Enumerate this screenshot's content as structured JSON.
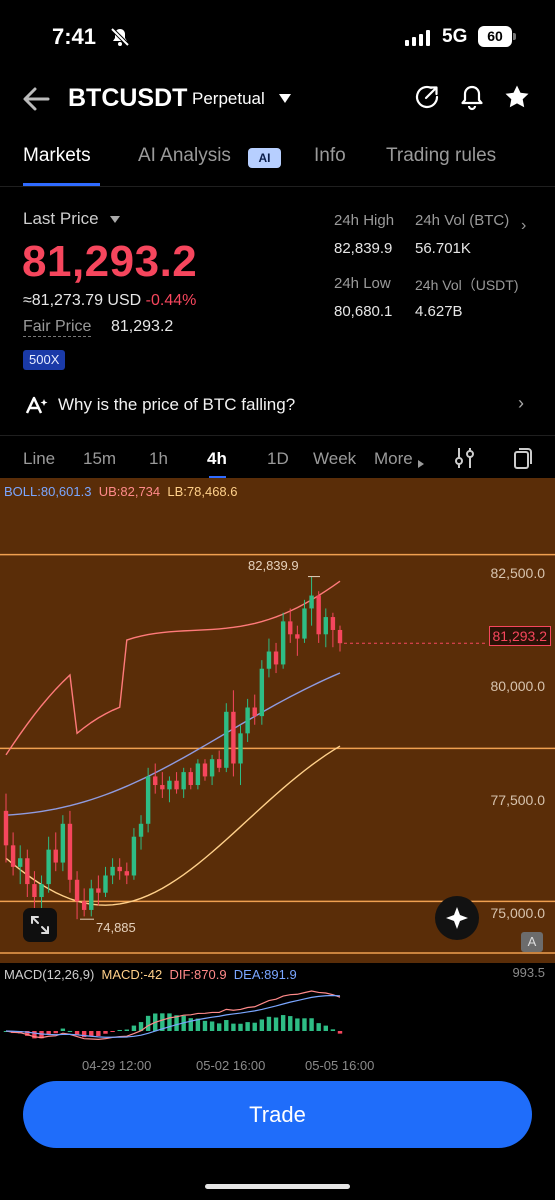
{
  "status_bar": {
    "time": "7:41",
    "network": "5G",
    "battery": "60"
  },
  "header": {
    "symbol": "BTCUSDT",
    "contract_type": "Perpetual"
  },
  "tabs": [
    {
      "label": "Markets",
      "active": true
    },
    {
      "label": "AI Analysis",
      "active": false
    },
    {
      "label": "Info",
      "active": false
    },
    {
      "label": "Trading rules",
      "active": false
    }
  ],
  "ai_badge": "AI",
  "price": {
    "last_price_label": "Last Price",
    "last_price": "81,293.2",
    "approx_usd": "≈81,273.79 USD",
    "change_pct": "-0.44%",
    "fair_price_label": "Fair Price",
    "fair_price": "81,293.2",
    "leverage": "500X"
  },
  "stats": {
    "high_label": "24h High",
    "high_value": "82,839.9",
    "vol_btc_label": "24h Vol (BTC)",
    "vol_btc_value": "56.701K",
    "low_label": "24h Low",
    "low_value": "80,680.1",
    "vol_usdt_label": "24h Vol（USDT)",
    "vol_usdt_value": "4.627B"
  },
  "insight": {
    "question": "Why is the price of BTC falling?"
  },
  "intervals": [
    {
      "label": "Line",
      "active": false
    },
    {
      "label": "15m",
      "active": false
    },
    {
      "label": "1h",
      "active": false
    },
    {
      "label": "4h",
      "active": true
    },
    {
      "label": "1D",
      "active": false
    },
    {
      "label": "Week",
      "active": false
    },
    {
      "label": "More",
      "active": false
    }
  ],
  "boll_legend": {
    "boll": "BOLL:80,601.3",
    "ub": "UB:82,734",
    "lb": "LB:78,468.6"
  },
  "macd_legend": {
    "params": "MACD(12,26,9)",
    "macd": "MACD:-42",
    "dif": "DIF:870.9",
    "dea": "DEA:891.9"
  },
  "macd_scale": "993.5",
  "annotations": {
    "high": "82,839.9",
    "low": "74,885"
  },
  "current_price_tag": "81,293.2",
  "axis_badge": "A",
  "colors": {
    "up": "#2ebd85",
    "down": "#f6465d",
    "accent": "#1f6dfa",
    "chart_bg": "#5a2d08"
  },
  "chart_data": {
    "type": "candlestick",
    "interval": "4h",
    "y_ticks": [
      "82,500.0",
      "80,000.0",
      "77,500.0",
      "75,000.0"
    ],
    "y_tick_values": [
      82500,
      80000,
      77500,
      75000
    ],
    "ylim": [
      74100,
      84200
    ],
    "x_ticks": [
      "04-29 12:00",
      "05-02 16:00",
      "05-05 16:00"
    ],
    "current_price": 81293.2,
    "high": 82839.9,
    "low": 74885,
    "horizontal_levels": [
      83350,
      78850,
      75300,
      74100
    ],
    "candles": [
      [
        77400,
        77800,
        76200,
        76600
      ],
      [
        76600,
        76900,
        75900,
        76100
      ],
      [
        76100,
        76600,
        75700,
        76300
      ],
      [
        76300,
        76500,
        75400,
        75700
      ],
      [
        75700,
        76000,
        75000,
        75400
      ],
      [
        75400,
        75900,
        75050,
        75700
      ],
      [
        75700,
        76800,
        75500,
        76500
      ],
      [
        76500,
        76900,
        76000,
        76200
      ],
      [
        76200,
        77300,
        76000,
        77100
      ],
      [
        77100,
        77400,
        75500,
        75800
      ],
      [
        75800,
        76000,
        74885,
        75300
      ],
      [
        75300,
        75600,
        74950,
        75100
      ],
      [
        75100,
        75800,
        74950,
        75600
      ],
      [
        75600,
        75900,
        75200,
        75500
      ],
      [
        75500,
        76100,
        75400,
        75900
      ],
      [
        75900,
        76300,
        75700,
        76100
      ],
      [
        76100,
        76300,
        75800,
        76000
      ],
      [
        76000,
        76200,
        75700,
        75900
      ],
      [
        75900,
        77000,
        75800,
        76800
      ],
      [
        76800,
        77300,
        76500,
        77100
      ],
      [
        77100,
        78400,
        76900,
        78200
      ],
      [
        78200,
        78500,
        77800,
        78000
      ],
      [
        78000,
        78300,
        77700,
        77900
      ],
      [
        77900,
        78200,
        77600,
        78100
      ],
      [
        78100,
        78300,
        77800,
        77900
      ],
      [
        77900,
        78400,
        77700,
        78300
      ],
      [
        78300,
        78400,
        77900,
        78000
      ],
      [
        78000,
        78600,
        77900,
        78500
      ],
      [
        78500,
        78600,
        78100,
        78200
      ],
      [
        78200,
        78700,
        78000,
        78600
      ],
      [
        78600,
        78800,
        78300,
        78400
      ],
      [
        78400,
        79900,
        78300,
        79700
      ],
      [
        79700,
        80200,
        78200,
        78500
      ],
      [
        78500,
        79400,
        78000,
        79200
      ],
      [
        79200,
        80000,
        79000,
        79800
      ],
      [
        79800,
        80100,
        79400,
        79600
      ],
      [
        79600,
        80900,
        79400,
        80700
      ],
      [
        80700,
        81400,
        80500,
        81100
      ],
      [
        81100,
        81300,
        80600,
        80800
      ],
      [
        80800,
        82000,
        80700,
        81800
      ],
      [
        81800,
        82100,
        81300,
        81500
      ],
      [
        81500,
        81700,
        81000,
        81400
      ],
      [
        81400,
        82300,
        81300,
        82100
      ],
      [
        82100,
        82839.9,
        81700,
        82400
      ],
      [
        82400,
        82500,
        81300,
        81500
      ],
      [
        81500,
        82100,
        81200,
        81900
      ],
      [
        81900,
        82000,
        81200,
        81600
      ],
      [
        81600,
        81700,
        81100,
        81293.2
      ]
    ],
    "boll_upper_start": 78700,
    "boll_upper_end": 82734,
    "boll_mid_start": 77300,
    "boll_mid_end": 80601.3,
    "boll_lower_start": 76300,
    "boll_lower_end": 78468.6
  }
}
